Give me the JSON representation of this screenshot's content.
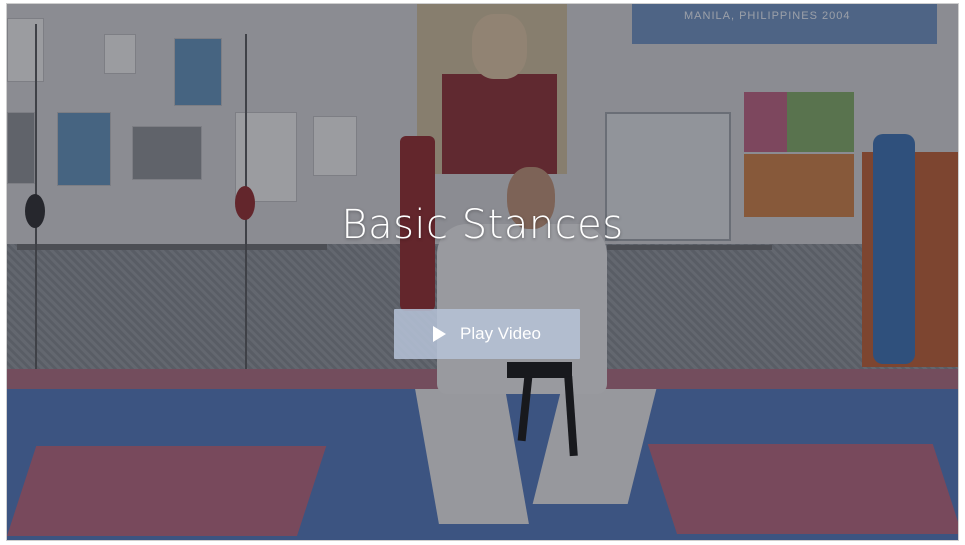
{
  "video": {
    "title": "Basic Stances",
    "play_label": "Play Video",
    "play_icon": "play-icon",
    "background_banner_text": "MANILA, PHILIPPINES 2004"
  },
  "colors": {
    "overlay": "#1e2028",
    "button_bg": "#b6c3d7",
    "text": "#ffffff"
  }
}
